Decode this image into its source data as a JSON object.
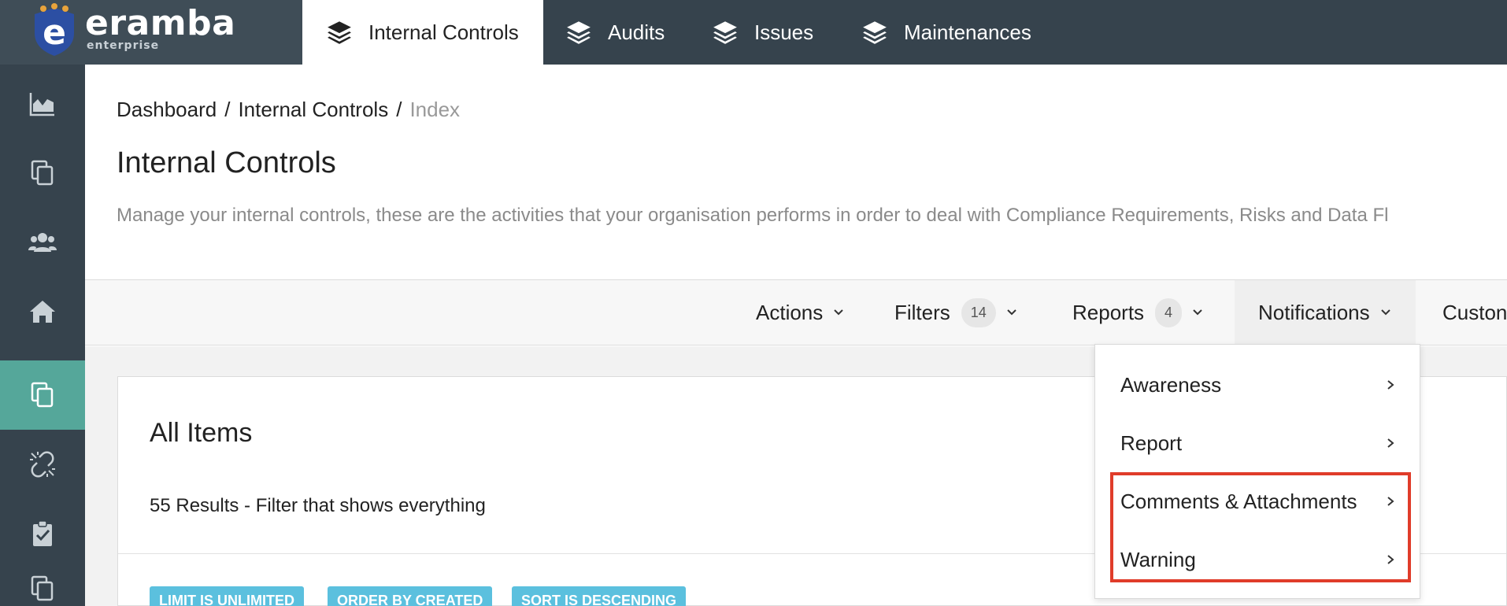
{
  "brand": {
    "name": "eramba",
    "edition": "enterprise"
  },
  "nav": {
    "tabs": [
      {
        "label": "Internal Controls",
        "active": true
      },
      {
        "label": "Audits",
        "active": false
      },
      {
        "label": "Issues",
        "active": false
      },
      {
        "label": "Maintenances",
        "active": false
      }
    ]
  },
  "sidebar": {
    "items": [
      {
        "icon": "area-chart-icon",
        "active": false
      },
      {
        "icon": "copy-icon",
        "active": false
      },
      {
        "icon": "users-icon",
        "active": false
      },
      {
        "icon": "home-icon",
        "active": false
      },
      {
        "icon": "copy-icon",
        "active": true
      },
      {
        "icon": "unlink-icon",
        "active": false
      },
      {
        "icon": "clipboard-check-icon",
        "active": false
      }
    ]
  },
  "breadcrumb": {
    "items": [
      "Dashboard",
      "Internal Controls"
    ],
    "current": "Index",
    "separator": "/"
  },
  "page": {
    "title": "Internal Controls",
    "description": "Manage your internal controls, these are the activities that your organisation performs in order to deal with Compliance Requirements, Risks and Data Fl"
  },
  "toolbar": {
    "actions": "Actions",
    "filters": {
      "label": "Filters",
      "count": "14"
    },
    "reports": {
      "label": "Reports",
      "count": "4"
    },
    "notifications": "Notifications",
    "custom": "Custon"
  },
  "notifications_menu": {
    "items": [
      {
        "label": "Awareness"
      },
      {
        "label": "Report"
      },
      {
        "label": "Comments & Attachments"
      },
      {
        "label": "Warning"
      }
    ]
  },
  "panel": {
    "title": "All Items",
    "results": "55 Results - Filter that shows everything",
    "pills": [
      "LIMIT IS UNLIMITED",
      "ORDER BY CREATED",
      "SORT IS DESCENDING"
    ]
  },
  "colors": {
    "topbar": "#36434d",
    "sidebar_active": "#55a79a",
    "highlight": "#e03c2a",
    "pill": "#5bc0de"
  }
}
